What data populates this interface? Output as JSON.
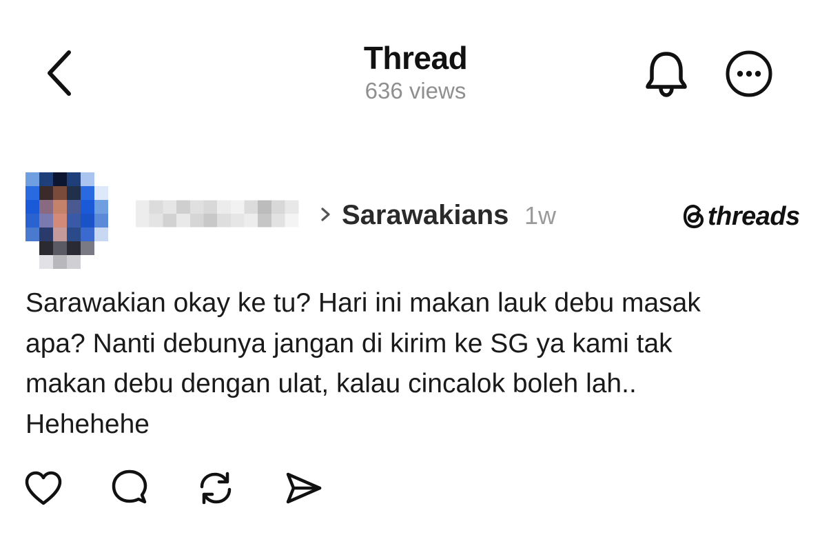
{
  "header": {
    "title": "Thread",
    "views": "636 views",
    "icons": {
      "back": "chevron-left-icon",
      "notify": "bell-icon",
      "more": "more-horizontal-icon"
    }
  },
  "post": {
    "username": "",
    "community": "Sarawakians",
    "time": "1w",
    "text": "Sarawakian okay ke tu? Hari ini makan lauk debu masak\napa? Nanti debunya jangan di kirim ke SG ya kami tak\nmakan debu dengan ulat, kalau cincalok boleh lah..\nHehehehe"
  },
  "brand": {
    "name": "threads"
  },
  "actions": {
    "icons": [
      "heart-icon",
      "comment-icon",
      "repost-icon",
      "share-icon"
    ]
  },
  "colors": {
    "text": "#1a1a1a",
    "muted": "#8f8f8f",
    "background": "#ffffff"
  }
}
